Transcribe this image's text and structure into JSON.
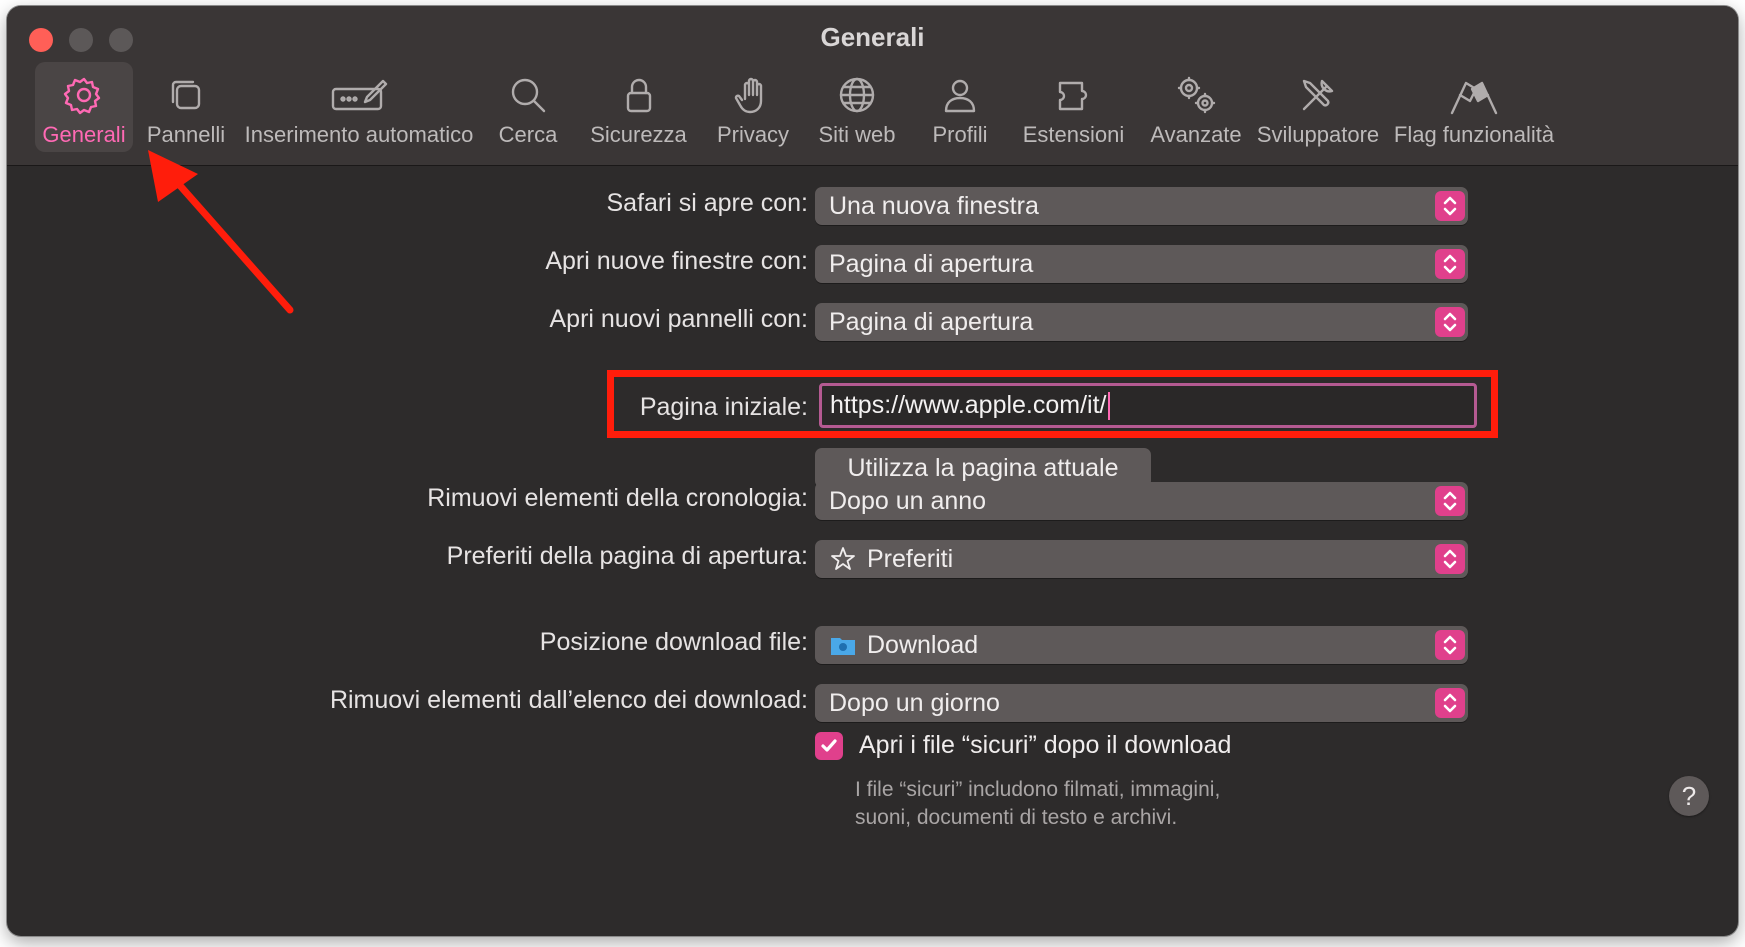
{
  "window": {
    "title": "Generali"
  },
  "toolbar": {
    "items": [
      {
        "label": "Generali",
        "icon": "gear-icon",
        "active": true
      },
      {
        "label": "Pannelli",
        "icon": "tabs-icon"
      },
      {
        "label": "Inserimento automatico",
        "icon": "autofill-icon"
      },
      {
        "label": "Cerca",
        "icon": "search-icon"
      },
      {
        "label": "Sicurezza",
        "icon": "lock-icon"
      },
      {
        "label": "Privacy",
        "icon": "hand-icon"
      },
      {
        "label": "Siti web",
        "icon": "globe-icon"
      },
      {
        "label": "Profili",
        "icon": "person-icon"
      },
      {
        "label": "Estensioni",
        "icon": "puzzle-icon"
      },
      {
        "label": "Avanzate",
        "icon": "gears-icon"
      },
      {
        "label": "Sviluppatore",
        "icon": "tools-icon"
      },
      {
        "label": "Flag funzionalità",
        "icon": "flags-icon"
      }
    ],
    "accent_color": "#ff69b4"
  },
  "settings": {
    "safari_opens_with": {
      "label": "Safari si apre con:",
      "value": "Una nuova finestra"
    },
    "new_windows_with": {
      "label": "Apri nuove finestre con:",
      "value": "Pagina di apertura"
    },
    "new_tabs_with": {
      "label": "Apri nuovi pannelli con:",
      "value": "Pagina di apertura"
    },
    "homepage": {
      "label": "Pagina iniziale:",
      "value": "https://www.apple.com/it/"
    },
    "use_current_page": "Utilizza la pagina attuale",
    "remove_history": {
      "label": "Rimuovi elementi della cronologia:",
      "value": "Dopo un anno"
    },
    "start_page_favorites": {
      "label": "Preferiti della pagina di apertura:",
      "value": "Preferiti",
      "icon": "star-icon"
    },
    "download_location": {
      "label": "Posizione download file:",
      "value": "Download",
      "icon": "folder-icon"
    },
    "remove_downloads": {
      "label": "Rimuovi elementi dall’elenco dei download:",
      "value": "Dopo un giorno"
    },
    "open_safe_files": {
      "label": "Apri i file “sicuri” dopo il download",
      "checked": true,
      "note_line1": "I file “sicuri” includono filmati, immagini,",
      "note_line2": "suoni, documenti di testo e archivi."
    }
  },
  "help": {
    "label": "?"
  },
  "colors": {
    "accent": "#e0408c",
    "annotation": "#ff1d0b",
    "background": "#2d2b2b"
  }
}
